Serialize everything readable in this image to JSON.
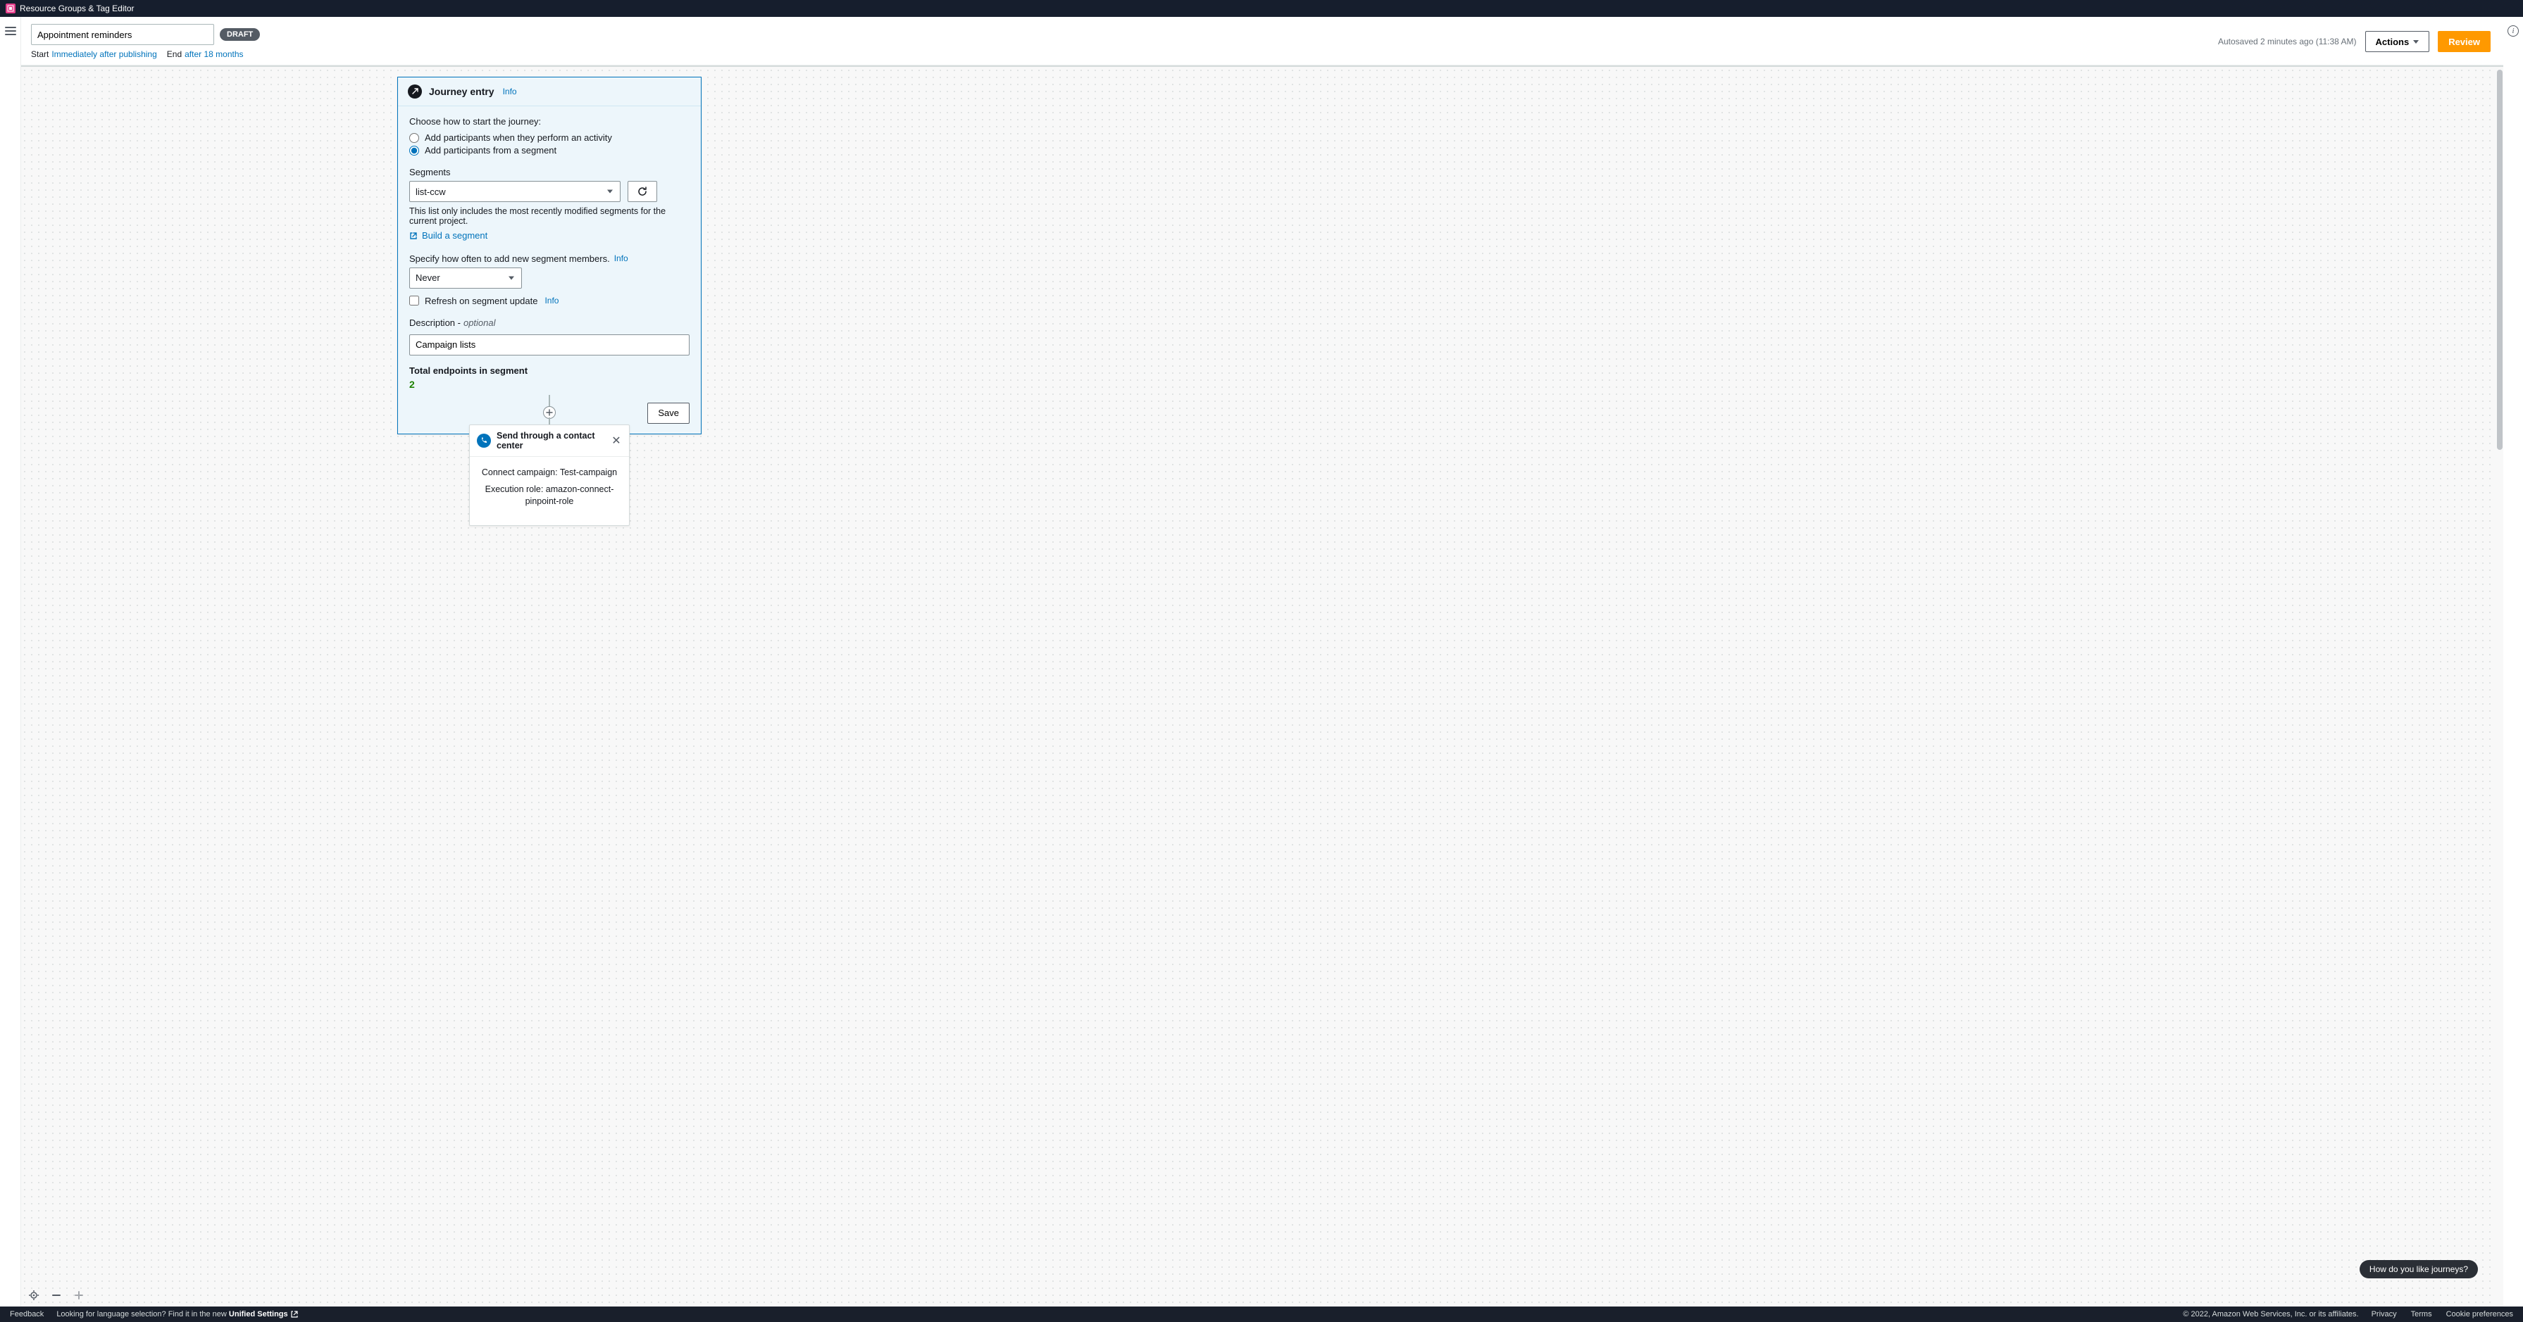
{
  "service_bar": {
    "title": "Resource Groups & Tag Editor"
  },
  "toolbar": {
    "journey_name": "Appointment reminders",
    "status_badge": "DRAFT",
    "start_label": "Start",
    "start_value": "Immediately after publishing",
    "end_label": "End",
    "end_value": "after 18 months",
    "autosave": "Autosaved 2 minutes ago (11:38 AM)",
    "actions_label": "Actions",
    "review_label": "Review"
  },
  "entry": {
    "title": "Journey entry",
    "info": "Info",
    "choose_label": "Choose how to start the journey:",
    "opt_activity": "Add participants when they perform an activity",
    "opt_segment": "Add participants from a segment",
    "segments_label": "Segments",
    "segment_value": "list-ccw",
    "segments_hint": "This list only includes the most recently modified segments for the current project.",
    "build_segment": "Build a segment",
    "freq_label": "Specify how often to add new segment members.",
    "freq_value": "Never",
    "refresh_label": "Refresh on segment update",
    "desc_label_main": "Description - ",
    "desc_label_opt": "optional",
    "desc_value": "Campaign lists",
    "total_label": "Total endpoints in segment",
    "total_value": "2",
    "save": "Save"
  },
  "cc": {
    "title": "Send through a contact center",
    "campaign_label": "Connect campaign: ",
    "campaign_value": "Test-campaign",
    "role_label": "Execution role: ",
    "role_value": "amazon-connect-pinpoint-role"
  },
  "feedback_pill": "How do you like journeys?",
  "footer": {
    "feedback": "Feedback",
    "lang_hint": "Looking for language selection? Find it in the new ",
    "unified": "Unified Settings",
    "copyright": "© 2022, Amazon Web Services, Inc. or its affiliates.",
    "privacy": "Privacy",
    "terms": "Terms",
    "cookie": "Cookie preferences"
  }
}
